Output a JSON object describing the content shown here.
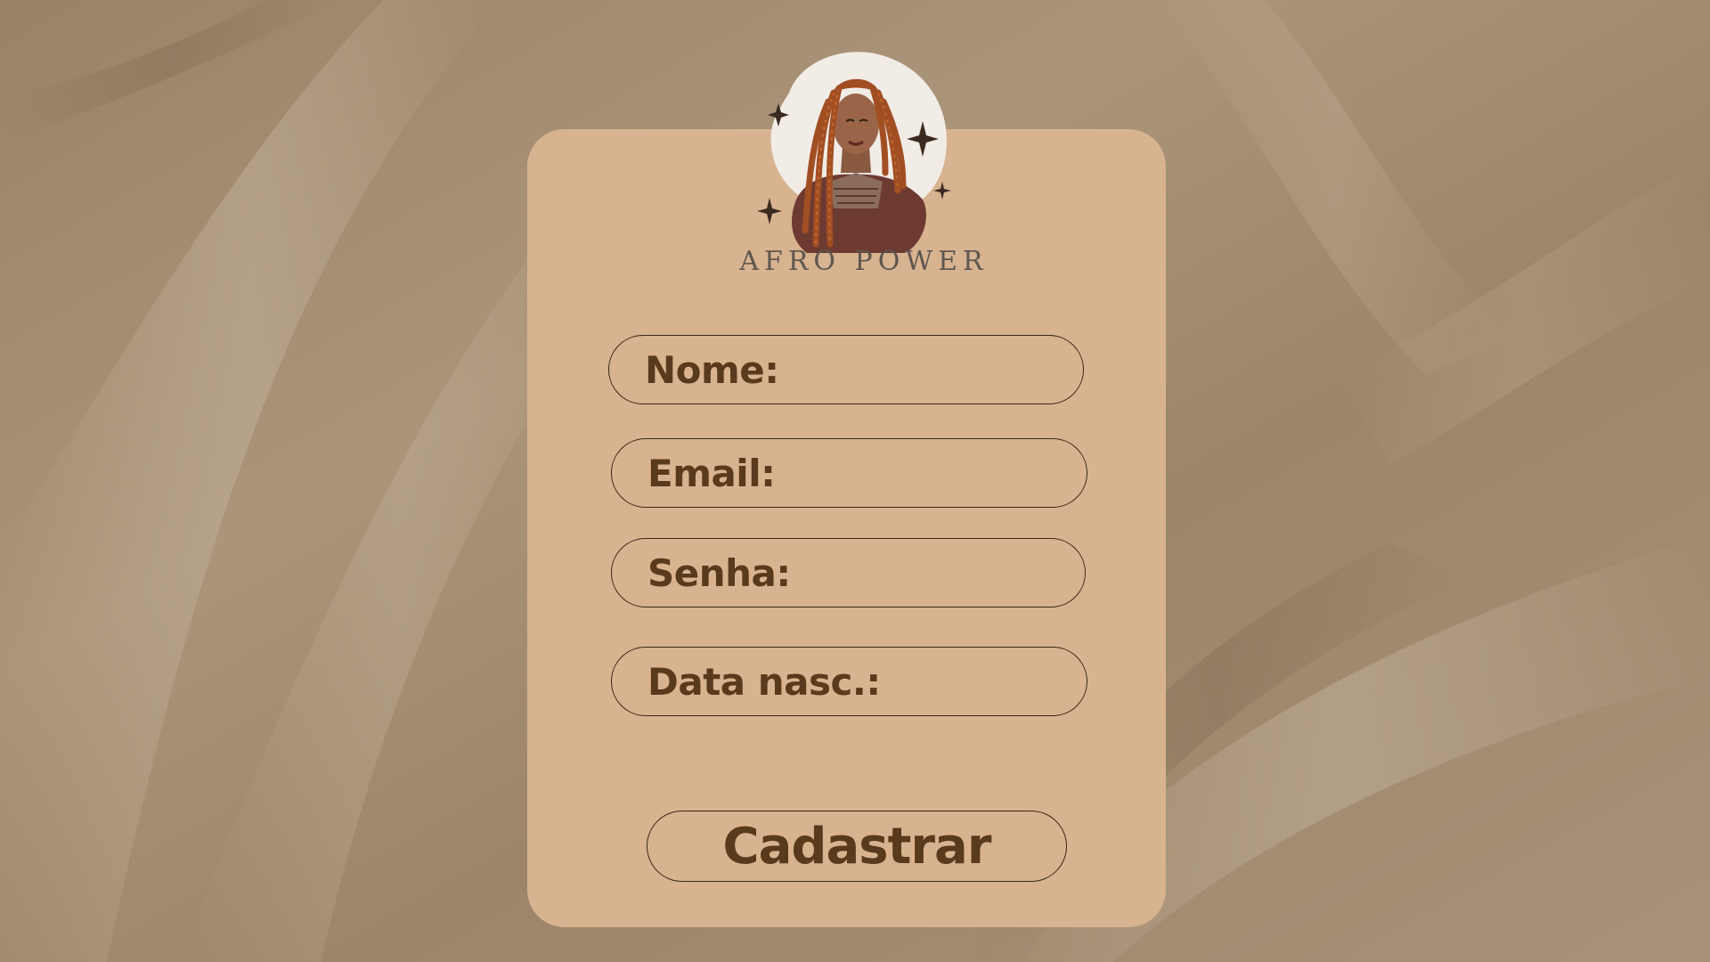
{
  "brand": {
    "name": "AFRO POWER",
    "logo_icon": "woman-with-braids-illustration"
  },
  "form": {
    "fields": [
      {
        "label": "Nome:"
      },
      {
        "label": "Email:"
      },
      {
        "label": "Senha:"
      },
      {
        "label": "Data nasc.:"
      }
    ],
    "submit_label": "Cadastrar"
  },
  "colors": {
    "background": "#a58f74",
    "card": "#d8b38f",
    "text": "#5a3a1c",
    "brand_text": "#5d5750",
    "border": "#3a2818"
  }
}
